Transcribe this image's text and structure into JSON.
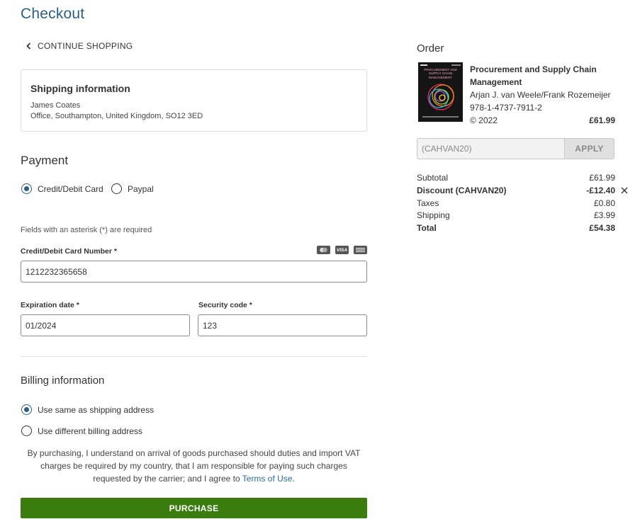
{
  "page": {
    "title": "Checkout"
  },
  "nav": {
    "continue_label": "CONTINUE SHOPPING"
  },
  "shipping": {
    "heading": "Shipping information",
    "name": "James Coates",
    "address": "Office, Southampton, United Kingdom, SO12 3ED"
  },
  "payment": {
    "heading": "Payment",
    "methods": [
      {
        "label": "Credit/Debit Card",
        "selected": true
      },
      {
        "label": "Paypal",
        "selected": false
      }
    ],
    "required_note": "Fields with an asterisk (*) are required",
    "card_number_label": "Credit/Debit Card Number *",
    "card_number_value": "1212232365658",
    "card_brands": [
      "mastercard-icon",
      "visa-icon",
      "amex-icon"
    ],
    "card_brand_text": {
      "visa": "VISA"
    },
    "expiry_label": "Expiration date *",
    "expiry_value": "01/2024",
    "security_label": "Security code *",
    "security_value": "123"
  },
  "billing": {
    "heading": "Billing information",
    "options": [
      {
        "label": "Use same as shipping address",
        "selected": true
      },
      {
        "label": "Use different billing address",
        "selected": false
      }
    ]
  },
  "legal": {
    "text": "By purchasing, I understand on arrival of goods purchased should duties and import VAT charges be required by my country, that I am responsible for paying such charges requested by the carrier; and I agree to ",
    "link": "Terms of Use",
    "end": "."
  },
  "purchase_label": "PURCHASE",
  "order": {
    "heading": "Order",
    "item": {
      "title": "Procurement and Supply Chain Management",
      "authors": "Arjan J. van Weele/Frank Rozemeijer",
      "isbn": "978-1-4737-7911-2",
      "year": "© 2022",
      "price": "£61.99",
      "cover_text": "PROCUREMENT AND SUPPLY CHAIN MANAGEMENT"
    },
    "coupon_value": "(CAHVAN20)",
    "apply_label": "APPLY",
    "summary": [
      {
        "label": "Subtotal",
        "value": "£61.99",
        "bold": false
      },
      {
        "label": "Discount (CAHVAN20)",
        "value": "-£12.40",
        "bold": true
      },
      {
        "label": "Taxes",
        "value": "£0.80",
        "bold": false
      },
      {
        "label": "Shipping",
        "value": "£3.99",
        "bold": false
      },
      {
        "label": "Total",
        "value": "£54.38",
        "bold": true
      }
    ]
  },
  "colors": {
    "accent": "#2a5f83",
    "purchase_button": "#3a7d0e",
    "link": "#2a6aa6"
  }
}
